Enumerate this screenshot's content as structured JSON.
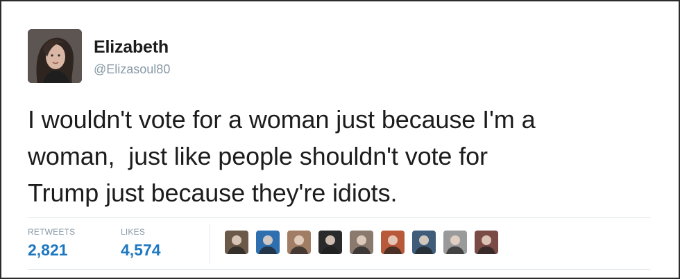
{
  "tweet": {
    "author": {
      "name": "Elizabeth",
      "handle": "@Elizasoul80"
    },
    "text": "I wouldn't vote for a woman just because I'm a\nwoman,  just like people shouldn't vote for\nTrump just because they're idiots."
  },
  "stats": {
    "retweets_label": "RETWEETS",
    "retweets_value": "2,821",
    "likes_label": "LIKES",
    "likes_value": "4,574"
  },
  "likers": [
    {
      "name": "liker-avatar-1",
      "color": "#6b5a4a"
    },
    {
      "name": "liker-avatar-2",
      "color": "#2f6fb0"
    },
    {
      "name": "liker-avatar-3",
      "color": "#a07d64"
    },
    {
      "name": "liker-avatar-4",
      "color": "#2a2a2a"
    },
    {
      "name": "liker-avatar-5",
      "color": "#8a7a6e"
    },
    {
      "name": "liker-avatar-6",
      "color": "#b85a3a"
    },
    {
      "name": "liker-avatar-7",
      "color": "#3f5d7a"
    },
    {
      "name": "liker-avatar-8",
      "color": "#9a9a9a"
    },
    {
      "name": "liker-avatar-9",
      "color": "#7a4a44"
    }
  ],
  "colors": {
    "link_blue": "#1d77c0",
    "muted_gray": "#8899a6",
    "text": "#1c1c1c",
    "divider": "#e1e8ed"
  }
}
